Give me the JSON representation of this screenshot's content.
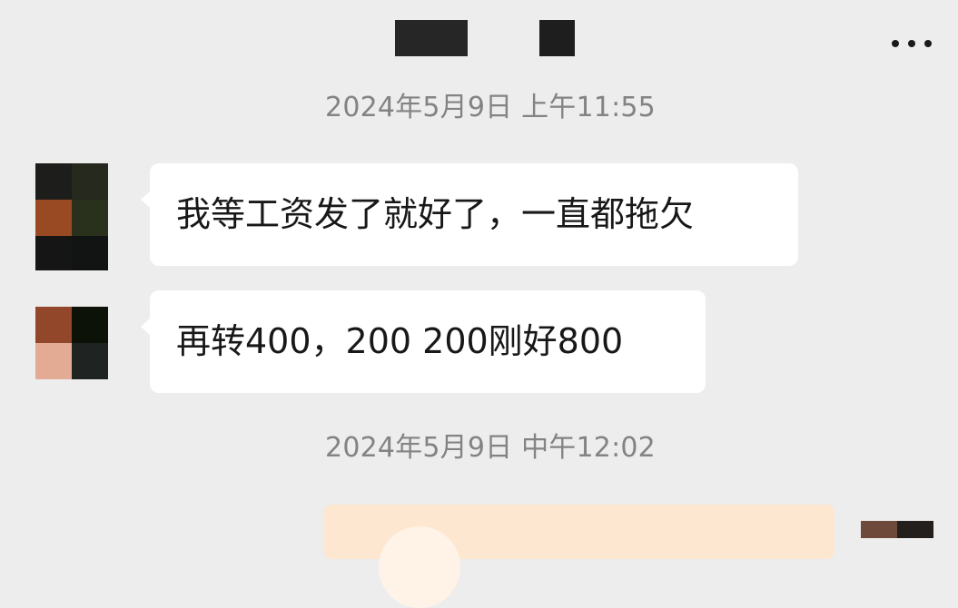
{
  "chat": {
    "timestamps": [
      "2024年5月9日 上午11:55",
      "2024年5月9日 中午12:02"
    ],
    "messages": [
      {
        "sender": "contact",
        "text": "我等工资发了就好了，一直都拖欠"
      },
      {
        "sender": "contact",
        "text": "再转400，200 200刚好800"
      }
    ]
  },
  "header": {
    "more_icon": "more-horizontal-icon"
  },
  "colors": {
    "background": "#ededed",
    "incoming_bubble": "#ffffff",
    "outgoing_bubble": "#fde7d1",
    "timestamp_text": "#838383",
    "message_text": "#181818"
  }
}
